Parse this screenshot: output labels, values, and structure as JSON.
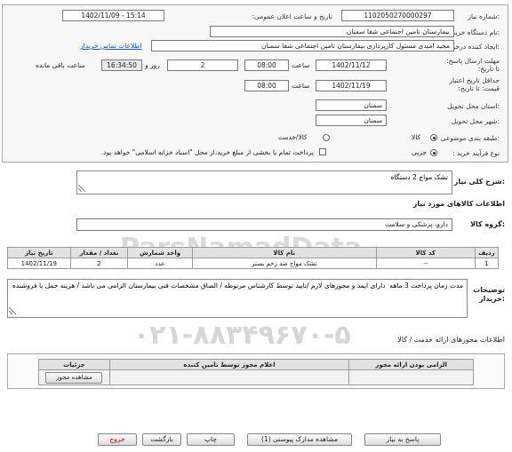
{
  "form": {
    "need_number": {
      "label": "شماره نیاز:",
      "value": "1102050270000297"
    },
    "announce_datetime": {
      "label": "تاریخ و ساعت اعلان عمومی:",
      "value": "1402/11/09 - 15:14"
    },
    "buyer_org": {
      "label": "نام دستگاه خریدار:",
      "value": "بیمارستان تامین اجتماعی شفا سمنان"
    },
    "requester": {
      "label": "ایجاد کننده درخواست:",
      "value": "مجید امیدی مسئول کارپردازی بیمارستان تامین اجتماعی شفا سمنان",
      "contact_link": "اطلاعات تماس خریدار"
    },
    "reply_deadline": {
      "label": "مهلت ارسال پاسخ: تا تاریخ:",
      "date": "1402/11/12",
      "time_label": "ساعت",
      "time": "08:00",
      "days": "2",
      "days_label": "روز و",
      "remaining": "16:34:50",
      "remaining_label": "ساعت باقی مانده"
    },
    "price_validity": {
      "label": "حداقل تاریخ اعتبار قیمت: تا تاریخ:",
      "date": "1402/11/19",
      "time_label": "ساعت",
      "time": "08:00"
    },
    "delivery_province": {
      "label": "استان محل تحویل:",
      "value": "سمنان"
    },
    "delivery_city": {
      "label": "شهر محل تحویل:",
      "value": "سمنان"
    },
    "subject_type": {
      "label": "طبقه بندی موضوعی:",
      "options": [
        "کالا",
        "کالا/خدمت"
      ],
      "selected": "کالا"
    },
    "purchase_process": {
      "label": "نوع فرآیند خرید :",
      "option": "جزیی",
      "note": "پرداخت تمام یا بخشی از مبلغ خرید،از محل \"اسناد خزانه اسلامی\" خواهد بود."
    }
  },
  "summary": {
    "label": "شرح کلی نیاز:",
    "value": "تشک مواج 2 دستگاه"
  },
  "goods": {
    "title": "اطلاعات کالاهای مورد نیاز",
    "group_label": "گروه کالا:",
    "group_value": "دارو، پزشکی و سلامت",
    "columns": [
      "ردیف",
      "کد کالا",
      "نام کالا",
      "واحد شمارش",
      "تعداد / مقدار",
      "تاریخ نیاز"
    ],
    "rows": [
      {
        "row": "1",
        "code": "--",
        "name": "تشک مواج ضد زخم بستر",
        "unit": "عدد",
        "qty": "2",
        "date": "1402/11/19"
      }
    ]
  },
  "notes": {
    "label": "توضیحات خریدار:",
    "value": "مدت زمان پرداخت 3 ماهه  دارای ایمد و مجوزهای لازم /تایید توسط کارشناس مربوطه / الصاق مشخصات فنی بیمارستان الزامی می باشد / هزینه حمل با فروشنده"
  },
  "permits": {
    "title": "اطلاعات مجوزهای ارائه خدمت / کالا",
    "columns": [
      "الزامی بودن ارائه مجوز",
      "اعلام مجوز توسط تامین کننده",
      "جزئیات"
    ],
    "view_button": "مشاهده مجوز"
  },
  "actions": {
    "reply": "پاسخ به نیاز",
    "attachments": "مشاهده مدارک پیوستی (1)",
    "print": "چاپ",
    "back": "بازگشت",
    "exit": "خروج"
  },
  "watermark": {
    "line1": "ParsNamadData",
    "line2": "پایگاه اطلاع رسانی مناقصه و مزایده",
    "phone": "۰۲۱-۸۸۳۴۹۶۷۰-۵"
  },
  "colors": {
    "link": "#1a55c0",
    "exit_text": "#bb0000"
  }
}
